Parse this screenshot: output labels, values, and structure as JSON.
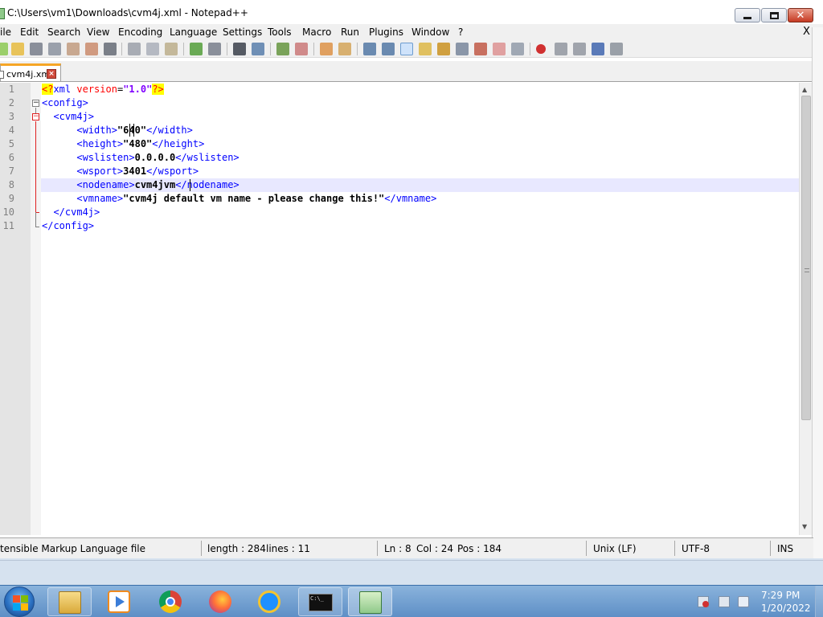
{
  "window": {
    "title": "C:\\Users\\vm1\\Downloads\\cvm4j.xml - Notepad++",
    "menu_close": "X"
  },
  "menu": [
    "ile",
    "Edit",
    "Search",
    "View",
    "Encoding",
    "Language",
    "Settings",
    "Tools",
    "Macro",
    "Run",
    "Plugins",
    "Window",
    "?"
  ],
  "tab": {
    "label": "cvm4j.xml",
    "close_glyph": "×"
  },
  "editor": {
    "line_numbers": [
      "1",
      "2",
      "3",
      "4",
      "5",
      "6",
      "7",
      "8",
      "9",
      "10",
      "11"
    ],
    "current_line": 8
  },
  "status": {
    "language": "tensible Markup Language file",
    "length": "length : 284",
    "lines": "lines : 11",
    "ln": "Ln : 8",
    "col": "Col : 24",
    "pos": "Pos : 184",
    "eol": "Unix (LF)",
    "encoding": "UTF-8",
    "mode": "INS"
  },
  "taskbar": {
    "apps": [
      "explorer-icon",
      "media-player-icon",
      "chrome-icon",
      "firefox-icon",
      "internet-explorer-icon",
      "command-prompt-icon",
      "notepad-plus-plus-icon"
    ],
    "cmd_glyph": "C:\\_",
    "time": "7:29 PM",
    "date": "1/20/2022"
  },
  "colors": {
    "tag": "#0000ff",
    "attribute": "#ff0000",
    "string": "#8000ff",
    "current_line": "#e8e8ff",
    "tab_accent": "#f6a626"
  }
}
